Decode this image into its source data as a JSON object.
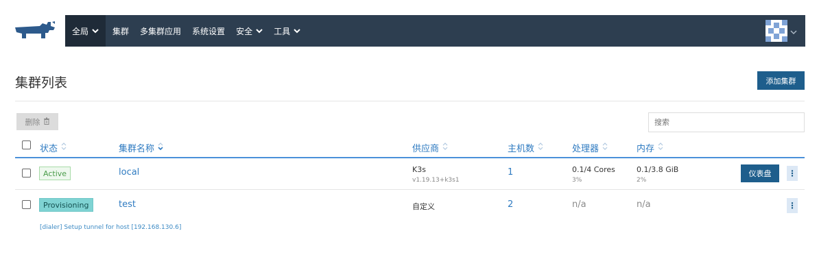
{
  "nav": {
    "items": [
      {
        "label": "全局",
        "has_dropdown": true,
        "active": true
      },
      {
        "label": "集群",
        "has_dropdown": false
      },
      {
        "label": "多集群应用",
        "has_dropdown": false
      },
      {
        "label": "系统设置",
        "has_dropdown": false
      },
      {
        "label": "安全",
        "has_dropdown": true
      },
      {
        "label": "工具",
        "has_dropdown": true
      }
    ],
    "bg_color": "#2d3e50",
    "logo_icon": "rancher-cow-logo",
    "avatar_icon": "user-avatar-identicon"
  },
  "page": {
    "title": "集群列表",
    "add_button": "添加集群"
  },
  "toolbar": {
    "delete_button": "删除",
    "delete_icon": "trash-icon",
    "search_placeholder": "搜索"
  },
  "table": {
    "columns": [
      "状态",
      "集群名称",
      "供应商",
      "主机数",
      "处理器",
      "内存"
    ],
    "rows": [
      {
        "state": "Active",
        "name": "local",
        "provider": "K3s",
        "provider_version": "v1.19.13+k3s1",
        "nodes": "1",
        "cpu": "0.1/4 Cores",
        "cpu_pct": "3%",
        "memory": "0.1/3.8 GiB",
        "memory_pct": "2%",
        "dashboard_button": "仪表盘"
      },
      {
        "state": "Provisioning",
        "name": "test",
        "provider": "自定义",
        "nodes": "2",
        "cpu": "n/a",
        "memory": "n/a",
        "message": "[dialer] Setup tunnel for host [192.168.130.6]"
      }
    ]
  },
  "colors": {
    "primary": "#1e5e8c",
    "link": "#2f7bc1",
    "active_badge": "#4a9b4a",
    "provisioning_badge": "#7fd3d3"
  }
}
